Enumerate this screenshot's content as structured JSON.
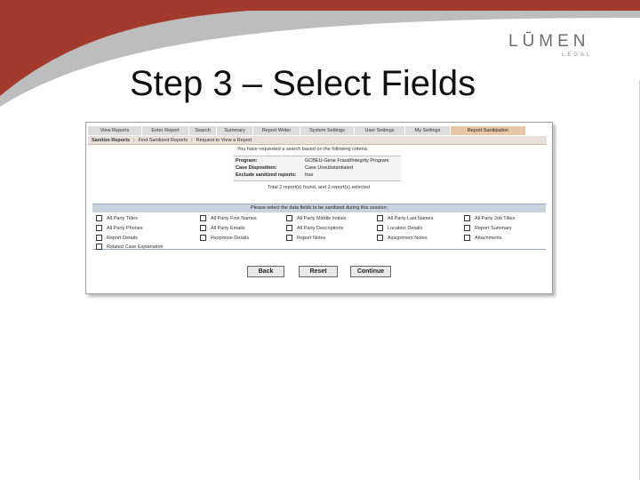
{
  "slide": {
    "title": "Step 3 – Select Fields"
  },
  "logo": {
    "main": "LŪMEN",
    "sub": "LEGAL"
  },
  "colors": {
    "swoosh_red": "#a33a2e",
    "swoosh_gray": "#bdbdbd",
    "active_tab": "#e8c6a6"
  },
  "tabs": [
    {
      "label": "View Reports",
      "active": false
    },
    {
      "label": "Enter Report",
      "active": false
    },
    {
      "label": "Search",
      "active": false
    },
    {
      "label": "Summary",
      "active": false
    },
    {
      "label": "Report Writer",
      "active": false
    },
    {
      "label": "System Settings",
      "active": false
    },
    {
      "label": "User Settings",
      "active": false
    },
    {
      "label": "My Settings",
      "active": false
    },
    {
      "label": "Report Sanitization",
      "active": true
    }
  ],
  "subnav": {
    "item1": "Sanitize Reports",
    "item2": "Find Sanitized Reports",
    "item3": "Request to View a Report"
  },
  "criteria": {
    "intro": "You have requested a search based on the following criteria:",
    "rows": [
      {
        "key": "Program:",
        "value": "GCBEU-Gene Fraud/Integrity Program"
      },
      {
        "key": "Case Disposition:",
        "value": "Case Unsubstantiated"
      },
      {
        "key": "Exclude sanitized reports:",
        "value": "true"
      }
    ],
    "found": "Total 2 report(s) found, and 2 report(s) selected"
  },
  "fields": {
    "heading": "Please select the data fields to be sanitized during this session:",
    "items": [
      "All Party Titles",
      "All Party First Names",
      "All Party Middle Initials",
      "All Party Last Names",
      "All Party Job Titles",
      "All Party Phones",
      "All Party Emails",
      "All Party Descriptions",
      "Location Details",
      "Report Summary",
      "Report Details",
      "Response Details",
      "Report Notes",
      "Assignment Notes",
      "Attachments",
      "Related Case Explanation"
    ]
  },
  "buttons": {
    "back": "Back",
    "reset": "Reset",
    "continue": "Continue"
  }
}
